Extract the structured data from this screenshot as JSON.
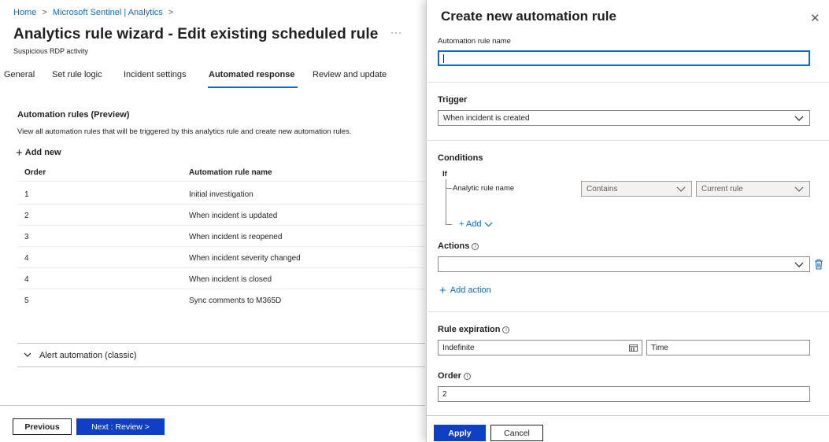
{
  "breadcrumb": {
    "items": [
      "Home",
      "Microsoft Sentinel | Analytics"
    ],
    "separator": ">"
  },
  "page": {
    "title": "Analytics rule wizard - Edit existing scheduled rule",
    "subtitle": "Suspicious RDP activity",
    "more": "···"
  },
  "tabs": [
    {
      "label": "General"
    },
    {
      "label": "Set rule logic"
    },
    {
      "label": "Incident settings"
    },
    {
      "label": "Automated response",
      "active": true
    },
    {
      "label": "Review and update"
    }
  ],
  "automation": {
    "title": "Automation rules (Preview)",
    "description": "View all automation rules that will be triggered by this analytics rule and create new automation rules.",
    "add_new": "Add new",
    "columns": [
      "Order",
      "Automation rule name"
    ],
    "rows": [
      {
        "order": "1",
        "name": "Initial investigation"
      },
      {
        "order": "2",
        "name": "When incident is updated"
      },
      {
        "order": "3",
        "name": "When incident is reopened"
      },
      {
        "order": "4",
        "name": "When incident severity changed"
      },
      {
        "order": "4",
        "name": "When incident is closed"
      },
      {
        "order": "5",
        "name": "Sync comments to M365D"
      }
    ]
  },
  "alert_automation": {
    "label": "Alert automation (classic)"
  },
  "footer": {
    "previous": "Previous",
    "next": "Next : Review >"
  },
  "panel": {
    "title": "Create new automation rule",
    "close": "✕",
    "name_label": "Automation rule name",
    "name_value": "",
    "trigger_label": "Trigger",
    "trigger_value": "When incident is created",
    "conditions_label": "Conditions",
    "if_label": "If",
    "condition": {
      "field": "Analytic rule name",
      "operator": "Contains",
      "value": "Current rule"
    },
    "add_condition": "+ Add",
    "actions_label": "Actions",
    "actions_value": "",
    "add_action": "Add action",
    "expiration_label": "Rule expiration",
    "expiration_date": "Indefinite",
    "expiration_time": "Time",
    "order_label": "Order",
    "order_value": "2",
    "apply": "Apply",
    "cancel": "Cancel"
  },
  "colors": {
    "accent": "#0f6cbd",
    "primary_button": "#0f3fc5",
    "text": "#201f1e"
  }
}
